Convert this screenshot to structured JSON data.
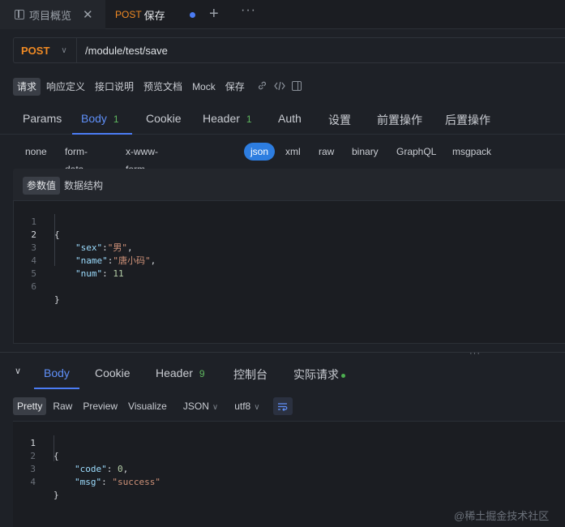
{
  "tabs": {
    "overview_label": "项目概览",
    "close_glyph": "✕",
    "request_method": "POST",
    "request_label": "保存",
    "add_glyph": "+",
    "more_glyph": "···"
  },
  "request": {
    "method": "POST",
    "method_chevron": "∨",
    "url": "/module/test/save"
  },
  "subbar": {
    "items": [
      "请求",
      "响应定义",
      "接口说明",
      "预览文档",
      "Mock"
    ],
    "save_label": "保存"
  },
  "req_tabs": {
    "items": [
      {
        "label": "Params",
        "count": ""
      },
      {
        "label": "Body",
        "count": "1"
      },
      {
        "label": "Cookie",
        "count": ""
      },
      {
        "label": "Header",
        "count": "1"
      },
      {
        "label": "Auth",
        "count": ""
      },
      {
        "label": "设置",
        "count": ""
      },
      {
        "label": "前置操作",
        "count": ""
      },
      {
        "label": "后置操作",
        "count": ""
      }
    ],
    "active": "Body"
  },
  "body_types": {
    "items": [
      "none",
      "form-data",
      "x-www-form-urlencoded",
      "json",
      "xml",
      "raw",
      "binary",
      "GraphQL",
      "msgpack"
    ],
    "active": "json"
  },
  "param_tabs": {
    "items": [
      "参数值",
      "数据结构"
    ],
    "active": "参数值"
  },
  "request_body": {
    "line_numbers": [
      "1",
      "2",
      "3",
      "4",
      "5",
      "6"
    ],
    "open_brace": "{",
    "close_brace": "}",
    "fields": [
      {
        "key": "\"sex\"",
        "sep": ":",
        "value": "\"男\"",
        "tail": ","
      },
      {
        "key": "\"name\"",
        "sep": ":",
        "value": "\"唐小码\"",
        "tail": ","
      },
      {
        "key": "\"num\"",
        "sep": ": ",
        "value": "11",
        "tail": ""
      }
    ]
  },
  "splitter_glyph": "···",
  "response_tabs": {
    "collapse_glyph": "∨",
    "items": [
      {
        "label": "Body",
        "count": ""
      },
      {
        "label": "Cookie",
        "count": ""
      },
      {
        "label": "Header",
        "count": "9"
      },
      {
        "label": "控制台",
        "count": ""
      },
      {
        "label": "实际请求",
        "count": ""
      }
    ],
    "active": "Body"
  },
  "format_bar": {
    "items": [
      "Pretty",
      "Raw",
      "Preview",
      "Visualize"
    ],
    "active": "Pretty",
    "format_select": "JSON",
    "encoding_select": "utf8",
    "chevron": "∨",
    "wrap_glyph": "⇌"
  },
  "response_body": {
    "line_numbers": [
      "1",
      "2",
      "3",
      "4"
    ],
    "open_brace": "{",
    "close_brace": "}",
    "fields": [
      {
        "key": "\"code\"",
        "sep": ": ",
        "value": "0",
        "tail": ","
      },
      {
        "key": "\"msg\"",
        "sep": ": ",
        "value": "\"success\"",
        "tail": ""
      }
    ]
  },
  "watermark": "@稀土掘金技术社区",
  "colors": {
    "accent_blue": "#4b7cf4",
    "method_orange": "#f08a24",
    "count_green": "#5fb85f"
  },
  "icons": [
    "overview-tab-icon",
    "link-icon",
    "code-icon",
    "sidebar-toggle-icon",
    "wrap-lines-icon"
  ]
}
